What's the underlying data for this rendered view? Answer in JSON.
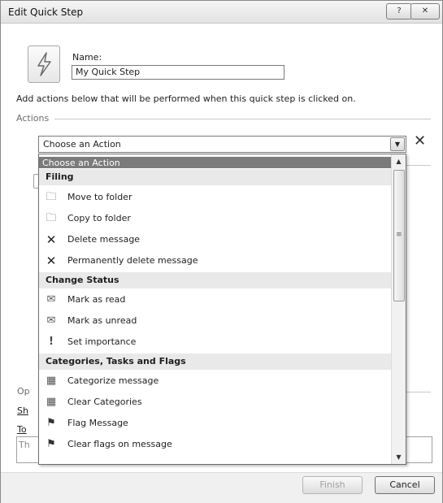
{
  "window": {
    "title": "Edit Quick Step",
    "help_label": "?",
    "close_label": "✕"
  },
  "form": {
    "name_label": "Name:",
    "name_value": "My Quick Step",
    "instructions": "Add actions below that will be performed when this quick step is clicked on.",
    "actions_label": "Actions"
  },
  "action_combo": {
    "value": "Choose an Action",
    "dropdown_glyph": "▼",
    "remove_glyph": "✕"
  },
  "dropdown": {
    "selected": "Choose an Action",
    "groups": [
      {
        "title": "Filing",
        "items": [
          {
            "label": "Move to folder",
            "icon": "move-to-folder-icon"
          },
          {
            "label": "Copy to folder",
            "icon": "copy-to-folder-icon"
          },
          {
            "label": "Delete message",
            "icon": "delete-icon"
          },
          {
            "label": "Permanently delete message",
            "icon": "permanent-delete-icon"
          }
        ]
      },
      {
        "title": "Change Status",
        "items": [
          {
            "label": "Mark as read",
            "icon": "mark-read-icon"
          },
          {
            "label": "Mark as unread",
            "icon": "mark-unread-icon"
          },
          {
            "label": "Set importance",
            "icon": "importance-icon"
          }
        ]
      },
      {
        "title": "Categories, Tasks and Flags",
        "items": [
          {
            "label": "Categorize message",
            "icon": "categorize-icon"
          },
          {
            "label": "Clear Categories",
            "icon": "clear-categories-icon"
          },
          {
            "label": "Flag Message",
            "icon": "flag-icon"
          },
          {
            "label": "Clear flags on message",
            "icon": "clear-flag-icon"
          }
        ]
      }
    ],
    "scroll_up_glyph": "▲",
    "scroll_down_glyph": "▼",
    "scroll_grip": "≡"
  },
  "background_fragments": {
    "options": "Op",
    "shortcut": "Sh",
    "tooltip": "To",
    "tooltip_text": "Th"
  },
  "footer": {
    "finish_label": "Finish",
    "cancel_label": "Cancel"
  }
}
